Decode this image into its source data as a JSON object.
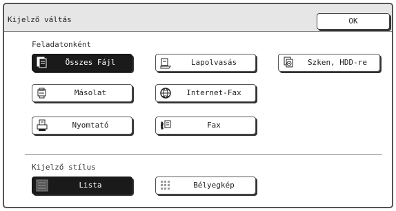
{
  "window": {
    "title": "Kijelző váltás",
    "ok_label": "OK"
  },
  "job_section": {
    "label": "Feladatonként",
    "buttons": [
      {
        "label": "Összes Fájl",
        "icon": "all-files-icon",
        "selected": true
      },
      {
        "label": "Lapolvasás",
        "icon": "scan-icon",
        "selected": false
      },
      {
        "label": "Szken, HDD-re",
        "icon": "scan-to-hdd-icon",
        "selected": false
      },
      {
        "label": "Másolat",
        "icon": "copy-icon",
        "selected": false
      },
      {
        "label": "Internet-Fax",
        "icon": "internet-fax-icon",
        "selected": false
      },
      {
        "label": "Nyomtató",
        "icon": "printer-icon",
        "selected": false
      },
      {
        "label": "Fax",
        "icon": "fax-icon",
        "selected": false
      }
    ]
  },
  "style_section": {
    "label": "Kijelző stílus",
    "buttons": [
      {
        "label": "Lista",
        "icon": "list-view-icon",
        "selected": true
      },
      {
        "label": "Bélyegkép",
        "icon": "thumbnail-view-icon",
        "selected": false
      }
    ]
  },
  "colors": {
    "selected_bg": "#1a1a1a",
    "titlebar_bg": "#e6e6e6",
    "border": "#555555"
  }
}
